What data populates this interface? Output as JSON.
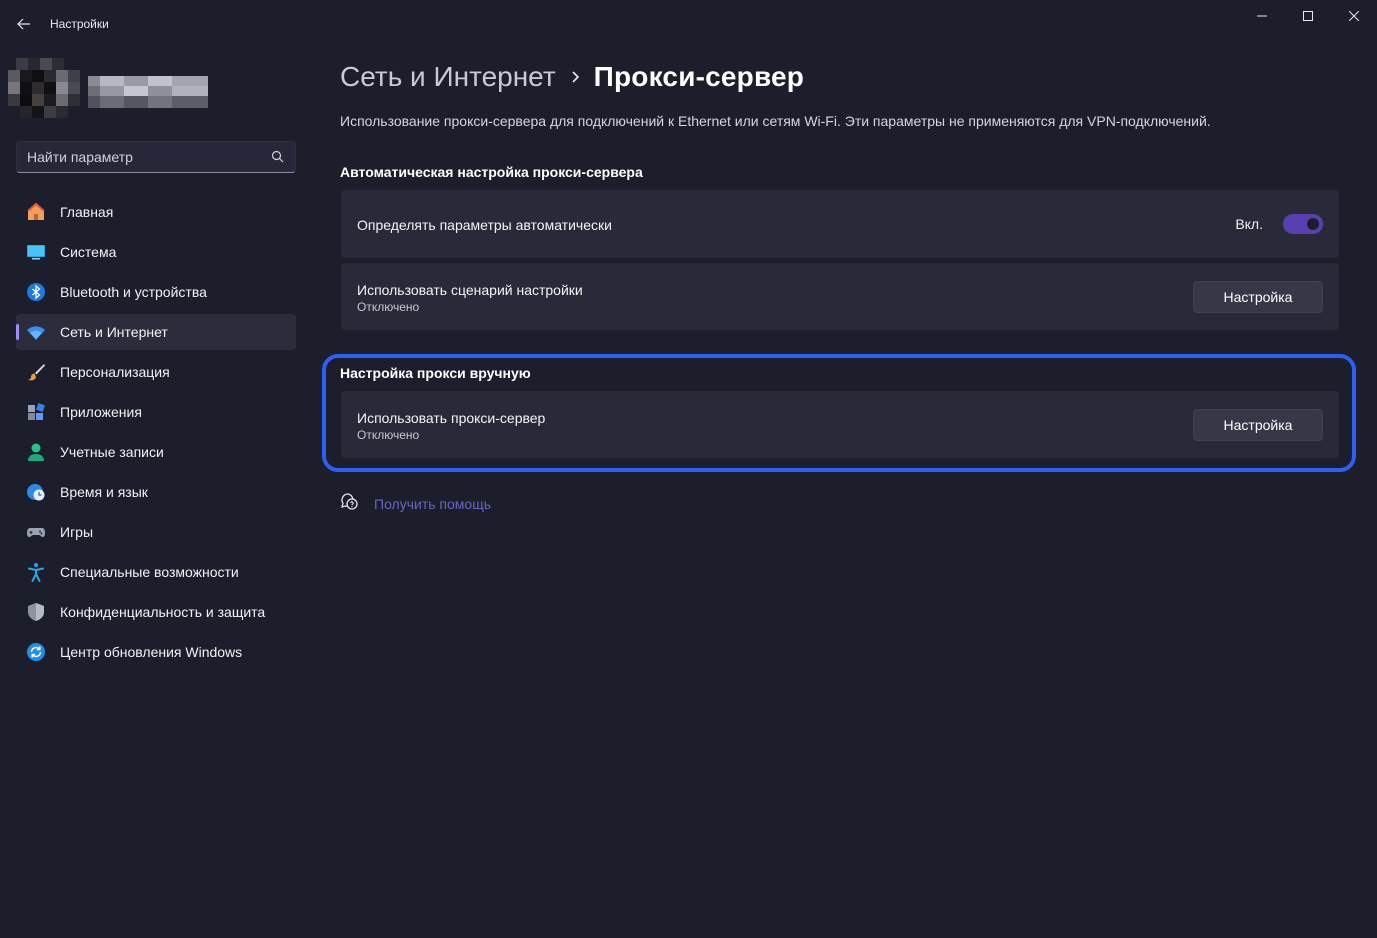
{
  "window": {
    "title": "Настройки",
    "controls": [
      "minimize-icon",
      "maximize-icon",
      "close-icon"
    ]
  },
  "sidebar": {
    "search": {
      "placeholder": "Найти параметр",
      "value": ""
    },
    "items": [
      {
        "label": "Главная",
        "icon": "home-icon",
        "active": false
      },
      {
        "label": "Система",
        "icon": "monitor-icon",
        "active": false
      },
      {
        "label": "Bluetooth и устройства",
        "icon": "bluetooth-icon",
        "active": false
      },
      {
        "label": "Сеть и Интернет",
        "icon": "wifi-icon",
        "active": true
      },
      {
        "label": "Персонализация",
        "icon": "brush-icon",
        "active": false
      },
      {
        "label": "Приложения",
        "icon": "apps-icon",
        "active": false
      },
      {
        "label": "Учетные записи",
        "icon": "user-icon",
        "active": false
      },
      {
        "label": "Время и язык",
        "icon": "globe-clock-icon",
        "active": false
      },
      {
        "label": "Игры",
        "icon": "gamepad-icon",
        "active": false
      },
      {
        "label": "Специальные возможности",
        "icon": "accessibility-icon",
        "active": false
      },
      {
        "label": "Конфиденциальность и защита",
        "icon": "shield-icon",
        "active": false
      },
      {
        "label": "Центр обновления Windows",
        "icon": "update-icon",
        "active": false
      }
    ]
  },
  "main": {
    "breadcrumb": {
      "parent": "Сеть и Интернет",
      "current": "Прокси-сервер"
    },
    "description": "Использование прокси-сервера для подключений к Ethernet или сетям Wi-Fi. Эти параметры не применяются для VPN-подключений.",
    "auto_section": {
      "title": "Автоматическая настройка прокси-сервера",
      "detect": {
        "label": "Определять параметры автоматически",
        "toggle_text": "Вкл.",
        "on": true
      },
      "script": {
        "label": "Использовать сценарий настройки",
        "status": "Отключено",
        "button": "Настройка"
      }
    },
    "manual_section": {
      "title": "Настройка прокси вручную",
      "proxy": {
        "label": "Использовать прокси-сервер",
        "status": "Отключено",
        "button": "Настройка"
      }
    },
    "help": {
      "label": "Получить помощь"
    }
  },
  "colors": {
    "background": "#1c1e2b",
    "card": "#282a39",
    "accent": "#5a3fb0",
    "highlight": "#2f5ef5",
    "link": "#6b63c4"
  }
}
